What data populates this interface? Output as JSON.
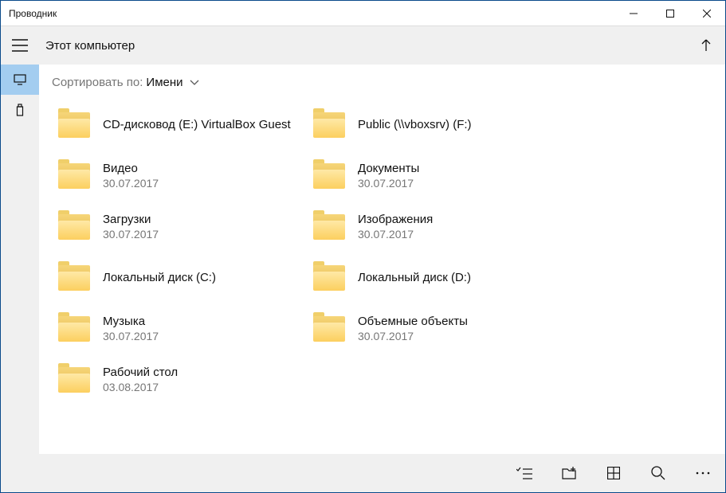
{
  "window": {
    "title": "Проводник"
  },
  "header": {
    "location": "Этот компьютер"
  },
  "sort": {
    "label": "Сортировать по:",
    "value": "Имени"
  },
  "items": [
    {
      "name": "CD-дисковод (E:) VirtualBox Guest",
      "date": ""
    },
    {
      "name": "Public (\\\\vboxsrv) (F:)",
      "date": ""
    },
    {
      "name": "Видео",
      "date": "30.07.2017"
    },
    {
      "name": "Документы",
      "date": "30.07.2017"
    },
    {
      "name": "Загрузки",
      "date": "30.07.2017"
    },
    {
      "name": "Изображения",
      "date": "30.07.2017"
    },
    {
      "name": "Локальный диск (C:)",
      "date": ""
    },
    {
      "name": "Локальный диск (D:)",
      "date": ""
    },
    {
      "name": "Музыка",
      "date": "30.07.2017"
    },
    {
      "name": "Объемные объекты",
      "date": "30.07.2017"
    },
    {
      "name": "Рабочий стол",
      "date": "03.08.2017"
    }
  ]
}
